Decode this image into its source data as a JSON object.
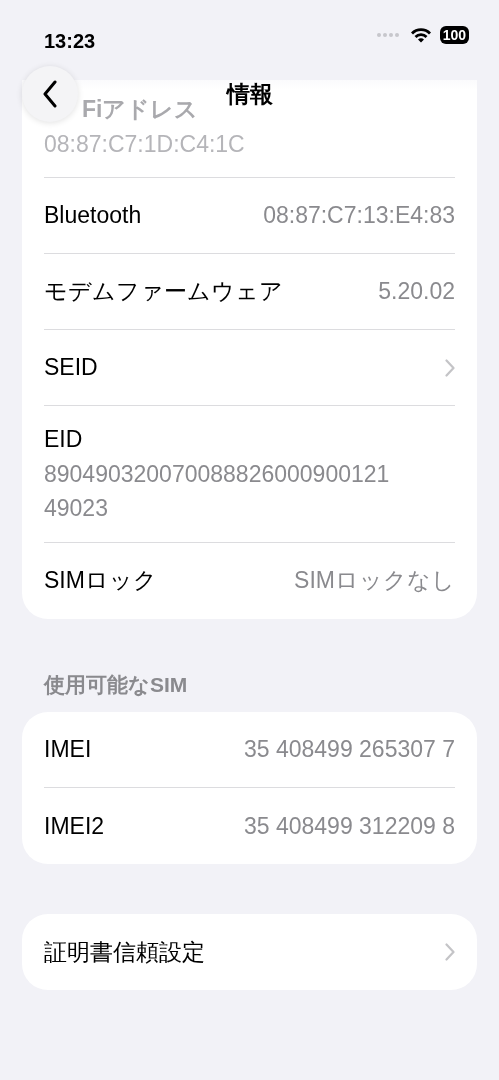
{
  "status_bar": {
    "time": "13:23",
    "battery": "100"
  },
  "nav": {
    "title": "情報"
  },
  "groups": [
    {
      "rows": [
        {
          "kind": "covered",
          "label": "Fiアドレス",
          "value_lines": [
            "08:87:C7:1D:C4:1C"
          ]
        },
        {
          "kind": "value",
          "label": "Bluetooth",
          "value": "08:87:C7:13:E4:83"
        },
        {
          "kind": "value",
          "label": "モデムファームウェア",
          "value": "5.20.02"
        },
        {
          "kind": "link",
          "label": "SEID"
        },
        {
          "kind": "stacked",
          "label": "EID",
          "value_lines": [
            "890490320070088826000900121",
            "49023"
          ]
        },
        {
          "kind": "value",
          "label": "SIMロック",
          "value": "SIMロックなし"
        }
      ]
    },
    {
      "header": "使用可能なSIM",
      "rows": [
        {
          "kind": "value",
          "label": "IMEI",
          "value": "35 408499 265307 7"
        },
        {
          "kind": "value",
          "label": "IMEI2",
          "value": "35 408499 312209 8"
        }
      ]
    },
    {
      "rows": [
        {
          "kind": "link",
          "label": "証明書信頼設定"
        }
      ]
    }
  ]
}
